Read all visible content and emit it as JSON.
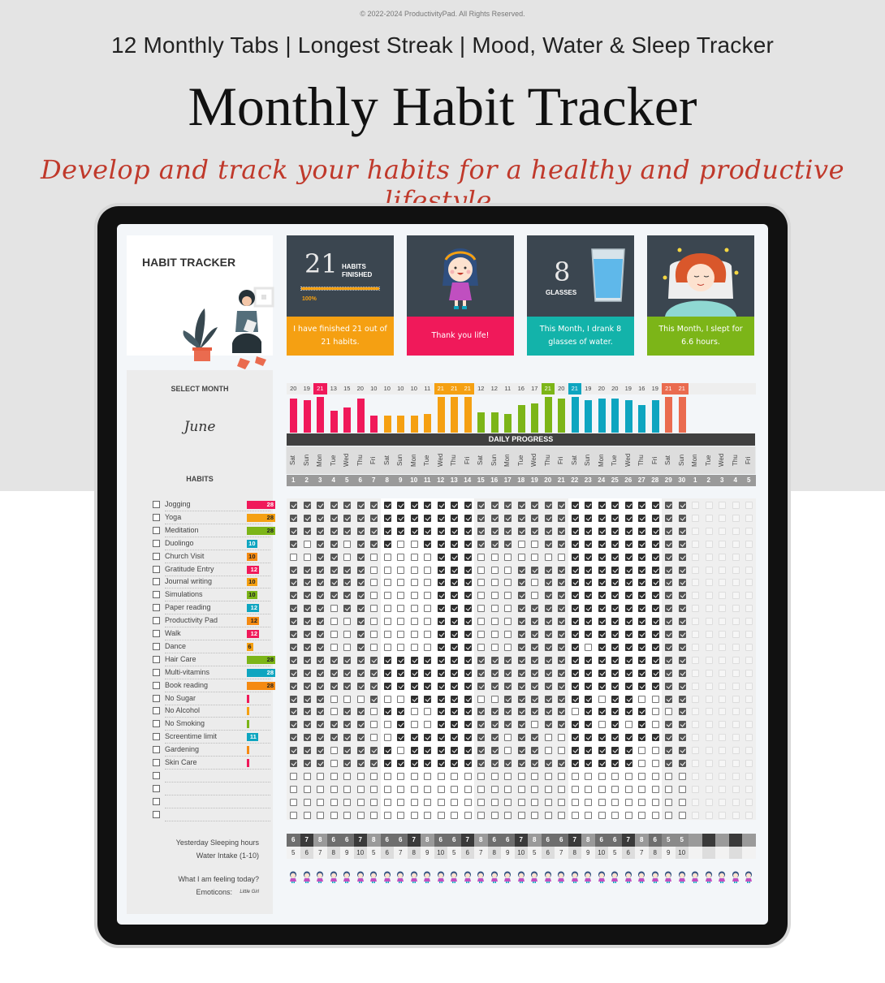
{
  "header": {
    "copyright": "© 2022-2024 ProductivityPad. All Rights Reserved.",
    "subtitle": "12 Monthly Tabs | Longest Streak | Mood, Water & Sleep Tracker",
    "title": "Monthly Habit Tracker",
    "tagline": "Develop and track your habits for a healthy and productive lifestyle."
  },
  "tracker": {
    "title": "HABIT TRACKER",
    "select_month_label": "SELECT MONTH",
    "month": "June",
    "habits_label": "HABITS",
    "daily_progress_label": "DAILY PROGRESS"
  },
  "cards": [
    {
      "big": "21",
      "line1": "HABITS",
      "line2": "FINISHED",
      "progress_label": "100%",
      "progress": 1.0,
      "message": "I have finished 21 out of 21 habits.",
      "color": "#f5a012"
    },
    {
      "message": "Thank you life!",
      "color": "#f0195a"
    },
    {
      "big": "8",
      "line1": "GLASSES",
      "message": "This Month, I drank 8 glasses of water.",
      "color": "#13b3aa"
    },
    {
      "message": "This Month, I slept for 6.6 hours.",
      "color": "#7cb518"
    }
  ],
  "days": {
    "weekdays": [
      "Sat",
      "Sun",
      "Mon",
      "Tue",
      "Wed",
      "Thu",
      "Fri",
      "Sat",
      "Sun",
      "Mon",
      "Tue",
      "Wed",
      "Thu",
      "Fri",
      "Sat",
      "Sun",
      "Mon",
      "Tue",
      "Wed",
      "Thu",
      "Fri",
      "Sat",
      "Sun",
      "Mon",
      "Tue",
      "Wed",
      "Thu",
      "Fri",
      "Sat",
      "Sun",
      "Mon",
      "Tue",
      "Wed",
      "Thu",
      "Fri"
    ],
    "numbers": [
      "1",
      "2",
      "3",
      "4",
      "5",
      "6",
      "7",
      "8",
      "9",
      "10",
      "11",
      "12",
      "13",
      "14",
      "15",
      "16",
      "17",
      "18",
      "19",
      "20",
      "21",
      "22",
      "23",
      "24",
      "25",
      "26",
      "27",
      "28",
      "29",
      "30",
      "1",
      "2",
      "3",
      "4",
      "5"
    ]
  },
  "chart_data": {
    "type": "bar",
    "title": "DAILY PROGRESS",
    "categories": [
      "1",
      "2",
      "3",
      "4",
      "5",
      "6",
      "7",
      "8",
      "9",
      "10",
      "11",
      "12",
      "13",
      "14",
      "15",
      "16",
      "17",
      "18",
      "19",
      "20",
      "21",
      "22",
      "23",
      "24",
      "25",
      "26",
      "27",
      "28",
      "29",
      "30"
    ],
    "values": [
      20,
      19,
      21,
      13,
      15,
      20,
      10,
      10,
      10,
      10,
      11,
      21,
      21,
      21,
      12,
      12,
      11,
      16,
      17,
      21,
      20,
      21,
      19,
      20,
      20,
      19,
      16,
      19,
      21,
      21
    ],
    "max": 21,
    "week_colors": [
      "#f0195a",
      "#f5a012",
      "#7cb518",
      "#0ea5c0",
      "#ea6b4f"
    ],
    "ylim": [
      0,
      21
    ]
  },
  "habits": [
    {
      "name": "Jogging",
      "streak": 28,
      "color": "#f0195a",
      "checks": "111111111111111111111111111111"
    },
    {
      "name": "Yoga",
      "streak": 28,
      "color": "#f5a012",
      "checks": "111111111111111111111111111111"
    },
    {
      "name": "Meditation",
      "streak": 28,
      "color": "#7cb518",
      "checks": "111111111111111111111111111111"
    },
    {
      "name": "Duolingo",
      "streak": 10,
      "color": "#0ea5c0",
      "checks": "101101110011111110011111111111"
    },
    {
      "name": "Church Visit",
      "streak": 10,
      "color": "#f58a12",
      "checks": "001101000001110000000111111111"
    },
    {
      "name": "Gratitude Entry",
      "streak": 12,
      "color": "#f0195a",
      "checks": "111111000001110001111111111111"
    },
    {
      "name": "Journal writing",
      "streak": 10,
      "color": "#f5a012",
      "checks": "111111000001110001011111111111"
    },
    {
      "name": "Simulations",
      "streak": 10,
      "color": "#7cb518",
      "checks": "111111000001110001011111111111"
    },
    {
      "name": "Paper reading",
      "streak": 12,
      "color": "#0ea5c0",
      "checks": "111011000001110001111111111111"
    },
    {
      "name": "Productivity Pad",
      "streak": 12,
      "color": "#f58a12",
      "checks": "111001000001110001111111111111"
    },
    {
      "name": "Walk",
      "streak": 12,
      "color": "#f0195a",
      "checks": "111001000001110001111111111111"
    },
    {
      "name": "Dance",
      "streak": 6,
      "color": "#f5a012",
      "checks": "111001000001110001111101111111"
    },
    {
      "name": "Hair Care",
      "streak": 28,
      "color": "#7cb518",
      "checks": "111111111111111111111111111111"
    },
    {
      "name": "Multi-vitamins",
      "streak": 28,
      "color": "#0ea5c0",
      "checks": "111111111111111111111111111111"
    },
    {
      "name": "Book reading",
      "streak": 28,
      "color": "#f58a12",
      "checks": "111111111111111111111111111111"
    },
    {
      "name": "No Sugar",
      "streak": 1,
      "color": "#f0195a",
      "checks": "111000100111110011111110110011"
    },
    {
      "name": "No Alcohol",
      "streak": 1,
      "color": "#f5a012",
      "checks": "111011011001111111111011111001"
    },
    {
      "name": "No Smoking",
      "streak": 2,
      "color": "#7cb518",
      "checks": "111111001001111111011110101011"
    },
    {
      "name": "Screentime limit",
      "streak": 11,
      "color": "#0ea5c0",
      "checks": "111111001111111101100111111111"
    },
    {
      "name": "Gardening",
      "streak": 2,
      "color": "#f58a12",
      "checks": "111011110111111101100111110011"
    },
    {
      "name": "Skin Care",
      "streak": 2,
      "color": "#f0195a",
      "checks": "111011111111111111111111110011"
    },
    {
      "name": "",
      "streak": null,
      "color": "",
      "checks": "000000000000000000000000000000"
    },
    {
      "name": "",
      "streak": null,
      "color": "",
      "checks": "000000000000000000000000000000"
    },
    {
      "name": "",
      "streak": null,
      "color": "",
      "checks": "000000000000000000000000000000"
    },
    {
      "name": "",
      "streak": null,
      "color": "",
      "checks": "000000000000000000000000000000"
    }
  ],
  "bottom": {
    "sleep_label": "Yesterday Sleeping hours",
    "water_label": "Water Intake (1-10)",
    "feeling_label": "What I am feeling today?",
    "emoticons_label": "Emoticons:",
    "emoticons_value": "Little Girl",
    "sleep": [
      "6",
      "7",
      "8",
      "6",
      "6",
      "7",
      "8",
      "6",
      "6",
      "7",
      "8",
      "6",
      "6",
      "7",
      "8",
      "6",
      "6",
      "7",
      "8",
      "6",
      "6",
      "7",
      "8",
      "6",
      "6",
      "7",
      "8",
      "6",
      "5",
      "5"
    ],
    "water": [
      "5",
      "6",
      "7",
      "8",
      "9",
      "10",
      "5",
      "6",
      "7",
      "8",
      "9",
      "10",
      "5",
      "6",
      "7",
      "8",
      "9",
      "10",
      "5",
      "6",
      "7",
      "8",
      "9",
      "10",
      "5",
      "6",
      "7",
      "8",
      "9",
      "10"
    ]
  }
}
